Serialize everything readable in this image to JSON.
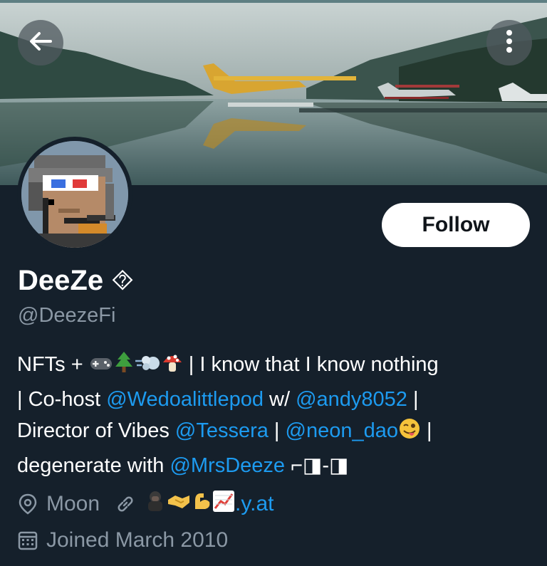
{
  "header": {
    "back_icon": "arrow-left-icon",
    "more_icon": "vertical-ellipsis-icon",
    "banner_description_icon": "seaplanes-lake-banner"
  },
  "profile": {
    "display_name": "DeeZe",
    "name_glyph": "⯑",
    "handle": "@DeezeFi",
    "follow_label": "Follow"
  },
  "bio": {
    "line1_text": "NFTs + ",
    "line1_rest": " | I know that I know nothing",
    "line2_pre": "| Co-host ",
    "line2_link1": "@Wedoalittlepod",
    "line2_mid": " w/ ",
    "line2_link2": "@andy8052",
    "line2_post": " |",
    "line3_pre": "Director of Vibes ",
    "line3_link1": "@Tessera",
    "line3_mid": " | ",
    "line3_link2": "@neon_dao",
    "line3_post": " |",
    "line4_pre": "degenerate with ",
    "line4_link": "@MrsDeeze",
    "line4_post": " ⌐◨-◨"
  },
  "meta": {
    "location": "Moon",
    "website_suffix": ".y.at",
    "joined": "Joined March 2010"
  },
  "colors": {
    "background": "#15202b",
    "link": "#1d9bf0",
    "secondary_text": "#8b98a5",
    "follow_bg": "#ffffff"
  }
}
